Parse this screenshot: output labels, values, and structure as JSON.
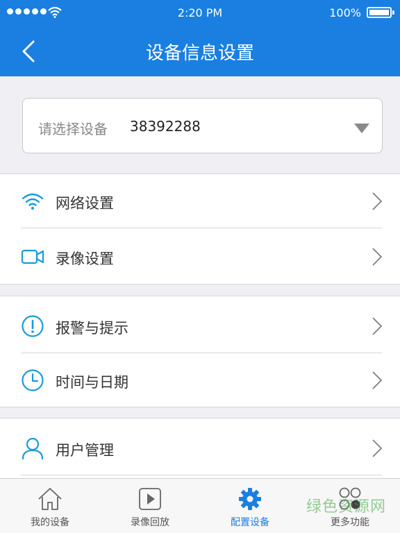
{
  "status_bar": {
    "time": "2:20 PM",
    "battery": "100%"
  },
  "nav": {
    "title": "设备信息设置",
    "back_icon": "chevron-left-icon"
  },
  "device_select": {
    "label": "请选择设备",
    "value": "38392288"
  },
  "menu": {
    "network": {
      "label": "网络设置",
      "icon": "wifi-icon"
    },
    "record": {
      "label": "录像设置",
      "icon": "video-camera-icon"
    },
    "alarm": {
      "label": "报警与提示",
      "icon": "alert-icon"
    },
    "datetime": {
      "label": "时间与日期",
      "icon": "clock-icon"
    },
    "users": {
      "label": "用户管理",
      "icon": "user-icon"
    }
  },
  "tabs": [
    {
      "label": "我的设备",
      "icon": "home-icon",
      "active": false
    },
    {
      "label": "录像回放",
      "icon": "play-icon",
      "active": false
    },
    {
      "label": "配置设备",
      "icon": "gear-icon",
      "active": true
    },
    {
      "label": "更多功能",
      "icon": "more-circles-icon",
      "active": false
    }
  ],
  "colors": {
    "primary": "#1a7fe0",
    "icon_blue": "#1a9ad8",
    "background": "#efeff4"
  },
  "watermark": "绿色资源网"
}
